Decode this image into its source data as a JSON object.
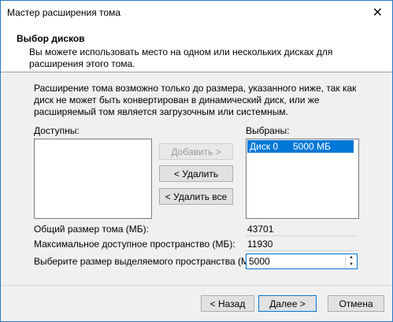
{
  "window": {
    "title": "Мастер расширения тома",
    "close_glyph": "✕"
  },
  "header": {
    "title": "Выбор дисков",
    "subtitle": "Вы можете использовать место на одном или нескольких дисках для расширения этого тома."
  },
  "intro": "Расширение тома возможно только до размера, указанного ниже, так как диск не может быть конвертирован в динамический диск, или же расширяемый том является загрузочным или системным.",
  "available": {
    "label": "Доступны:"
  },
  "selected": {
    "label": "Выбраны:",
    "item_disk": "Диск 0",
    "item_size": "5000 МБ"
  },
  "buttons": {
    "add": "Добавить >",
    "remove": "< Удалить",
    "remove_all": "< Удалить все",
    "back": "< Назад",
    "next": "Далее >",
    "cancel": "Отмена"
  },
  "fields": {
    "total_label": "Общий размер тома (МБ):",
    "total_value": "43701",
    "max_label": "Максимальное доступное пространство (МБ):",
    "max_value": "11930",
    "alloc_label": "Выберите размер выделяемого пространства (МБ):",
    "alloc_value": "5000"
  }
}
